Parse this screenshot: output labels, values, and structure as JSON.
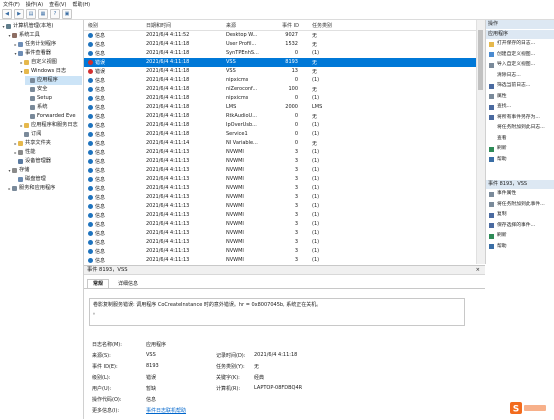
{
  "menu": [
    "文件(F)",
    "操作(A)",
    "查看(V)",
    "帮助(H)"
  ],
  "tree": [
    {
      "label": "计算机管理(本地)",
      "indent": 0,
      "arrow": "v",
      "icon": "#607d8b"
    },
    {
      "label": "系统工具",
      "indent": 1,
      "arrow": "v",
      "icon": "#8d6e63"
    },
    {
      "label": "任务计划程序",
      "indent": 2,
      "arrow": ">",
      "icon": "#6d8db5"
    },
    {
      "label": "事件查看器",
      "indent": 2,
      "arrow": "v",
      "icon": "#6d8db5"
    },
    {
      "label": "自定义视图",
      "indent": 3,
      "arrow": ">",
      "icon": "#e6b84c"
    },
    {
      "label": "Windows 日志",
      "indent": 3,
      "arrow": "v",
      "icon": "#e6b84c"
    },
    {
      "label": "应用程序",
      "indent": 4,
      "arrow": "",
      "icon": "#7a8a9a",
      "selected": true
    },
    {
      "label": "安全",
      "indent": 4,
      "arrow": "",
      "icon": "#7a8a9a"
    },
    {
      "label": "Setup",
      "indent": 4,
      "arrow": "",
      "icon": "#7a8a9a"
    },
    {
      "label": "系统",
      "indent": 4,
      "arrow": "",
      "icon": "#7a8a9a"
    },
    {
      "label": "Forwarded Eve",
      "indent": 4,
      "arrow": "",
      "icon": "#7a8a9a"
    },
    {
      "label": "应用程序和服务日志",
      "indent": 3,
      "arrow": ">",
      "icon": "#e6b84c"
    },
    {
      "label": "订阅",
      "indent": 3,
      "arrow": "",
      "icon": "#7a8a9a"
    },
    {
      "label": "共享文件夹",
      "indent": 2,
      "arrow": ">",
      "icon": "#e6b84c"
    },
    {
      "label": "性能",
      "indent": 2,
      "arrow": ">",
      "icon": "#8a8a8a"
    },
    {
      "label": "设备管理器",
      "indent": 2,
      "arrow": "",
      "icon": "#5a7aa0"
    },
    {
      "label": "存储",
      "indent": 1,
      "arrow": "v",
      "icon": "#8a8a8a"
    },
    {
      "label": "磁盘管理",
      "indent": 2,
      "arrow": "",
      "icon": "#6a8ab0"
    },
    {
      "label": "服务和应用程序",
      "indent": 1,
      "arrow": ">",
      "icon": "#7a8a9a"
    }
  ],
  "list": {
    "headers": [
      "级别",
      "日期和时间",
      "来源",
      "事件 ID",
      "任务类别"
    ],
    "rows": [
      [
        "信息",
        "2021/6/4 4:11:52",
        "Desktop W...",
        "9027",
        "无"
      ],
      [
        "信息",
        "2021/6/4 4:11:18",
        "User Profil...",
        "1532",
        "无"
      ],
      [
        "信息",
        "2021/6/4 4:11:18",
        "SynTPEnhS...",
        "0",
        "(1)"
      ],
      [
        "错误",
        "2021/6/4 4:11:18",
        "VSS",
        "8193",
        "无"
      ],
      [
        "错误",
        "2021/6/4 4:11:18",
        "VSS",
        "13",
        "无"
      ],
      [
        "信息",
        "2021/6/4 4:11:18",
        "nipxicms",
        "0",
        "(1)"
      ],
      [
        "信息",
        "2021/6/4 4:11:18",
        "niZeroconf...",
        "100",
        "无"
      ],
      [
        "信息",
        "2021/6/4 4:11:18",
        "nipxicms",
        "0",
        "(1)"
      ],
      [
        "信息",
        "2021/6/4 4:11:18",
        "LMS",
        "2000",
        "LMS"
      ],
      [
        "信息",
        "2021/6/4 4:11:18",
        "RtkAudioU...",
        "0",
        "无"
      ],
      [
        "信息",
        "2021/6/4 4:11:18",
        "IpOverUsb...",
        "0",
        "(1)"
      ],
      [
        "信息",
        "2021/6/4 4:11:18",
        "Service1",
        "0",
        "(1)"
      ],
      [
        "信息",
        "2021/6/4 4:11:14",
        "NI Variable...",
        "0",
        "无"
      ],
      [
        "信息",
        "2021/6/4 4:11:13",
        "NVWMI",
        "3",
        "(1)"
      ],
      [
        "信息",
        "2021/6/4 4:11:13",
        "NVWMI",
        "3",
        "(1)"
      ],
      [
        "信息",
        "2021/6/4 4:11:13",
        "NVWMI",
        "3",
        "(1)"
      ],
      [
        "信息",
        "2021/6/4 4:11:13",
        "NVWMI",
        "3",
        "(1)"
      ],
      [
        "信息",
        "2021/6/4 4:11:13",
        "NVWMI",
        "3",
        "(1)"
      ],
      [
        "信息",
        "2021/6/4 4:11:13",
        "NVWMI",
        "3",
        "(1)"
      ],
      [
        "信息",
        "2021/6/4 4:11:13",
        "NVWMI",
        "3",
        "(1)"
      ],
      [
        "信息",
        "2021/6/4 4:11:13",
        "NVWMI",
        "3",
        "(1)"
      ],
      [
        "信息",
        "2021/6/4 4:11:13",
        "NVWMI",
        "3",
        "(1)"
      ],
      [
        "信息",
        "2021/6/4 4:11:13",
        "NVWMI",
        "3",
        "(1)"
      ],
      [
        "信息",
        "2021/6/4 4:11:13",
        "NVWMI",
        "3",
        "(1)"
      ],
      [
        "信息",
        "2021/6/4 4:11:13",
        "NVWMI",
        "3",
        "(1)"
      ],
      [
        "信息",
        "2021/6/4 4:11:13",
        "NVWMI",
        "3",
        "(1)"
      ]
    ],
    "selected_index": 3
  },
  "detail": {
    "title": "事件 8193，VSS",
    "close": "×",
    "tabs": [
      "常规",
      "详细信息"
    ],
    "message": "卷影复制服务错误: 调用程序 CoCreateInstance 时的意外错误。hr = 0x8007045b, 系统正在关机。",
    "message_cont": "。",
    "fields": {
      "log_name_label": "日志名称(M):",
      "log_name": "应用程序",
      "source_label": "来源(S):",
      "source": "VSS",
      "recorded_label": "记录时间(D):",
      "recorded": "2021/6/4 4:11:18",
      "event_id_label": "事件 ID(E):",
      "event_id": "8193",
      "task_label": "任务类别(Y):",
      "task": "无",
      "level_label": "级别(L):",
      "level": "错误",
      "keywords_label": "关键字(K):",
      "keywords": "经典",
      "user_label": "用户(U):",
      "user": "暂缺",
      "computer_label": "计算机(R):",
      "computer": "LAPTOP-08FDBQ4R",
      "opcode_label": "操作代码(O):",
      "opcode": "信息",
      "more_label": "更多信息(I):",
      "more_link": "事件日志联机帮助"
    }
  },
  "actions": {
    "header1": "操作",
    "section1": "应用程序",
    "items1": [
      {
        "label": "打开保存的日志...",
        "icon": "#e6b84c"
      },
      {
        "label": "创建自定义视图...",
        "icon": "#4a8ad0"
      },
      {
        "label": "导入自定义视图...",
        "icon": "#7a8a9a"
      },
      {
        "label": "清除日志...",
        "icon": "#ffffff"
      },
      {
        "label": "筛选当前日志...",
        "icon": "#4a6aa0"
      },
      {
        "label": "属性",
        "icon": "#7a8a9a"
      },
      {
        "label": "查找...",
        "icon": "#4a6aa0"
      },
      {
        "label": "将所有事件另存为...",
        "icon": "#4a6aa0"
      },
      {
        "label": "将任务附加到此日志...",
        "icon": "#ffffff"
      },
      {
        "label": "查看",
        "icon": "#ffffff"
      },
      {
        "label": "刷新",
        "icon": "#2e8b57"
      },
      {
        "label": "帮助",
        "icon": "#3a6ea5"
      }
    ],
    "section2": "事件 8193，VSS",
    "items2": [
      {
        "label": "事件属性",
        "icon": "#7a8a9a"
      },
      {
        "label": "将任务附加到此事件...",
        "icon": "#7a8a9a"
      },
      {
        "label": "复制",
        "icon": "#4a6aa0"
      },
      {
        "label": "保存选择的事件...",
        "icon": "#4a6aa0"
      },
      {
        "label": "刷新",
        "icon": "#2e8b57"
      },
      {
        "label": "帮助",
        "icon": "#3a6ea5"
      }
    ]
  },
  "colors": {
    "selected": "#0078d7",
    "info_icon": "#1e73be",
    "error_icon": "#d32f2f",
    "accent": "#dde8f3"
  }
}
